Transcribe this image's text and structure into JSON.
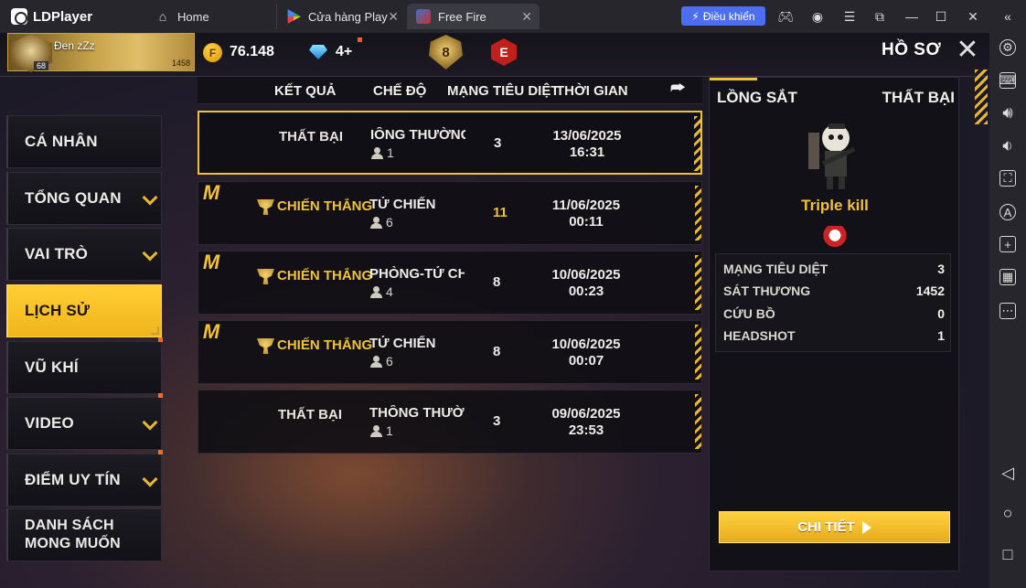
{
  "emulator": {
    "brand": "LDPlayer",
    "tabs": [
      {
        "label": "Home"
      },
      {
        "label": "Cửa hàng Play"
      },
      {
        "label": "Free Fire"
      }
    ],
    "control_button": "Điều khiển"
  },
  "header": {
    "player_name": "Đen zZz",
    "player_level": "68",
    "player_uid": "1458",
    "coins": "76.148",
    "diamonds": "4+",
    "rank_badge": "8",
    "rank_letter": "E",
    "title": "HỒ SƠ"
  },
  "nav": {
    "items": [
      {
        "label": "CÁ NHÂN",
        "active": false
      },
      {
        "label": "TỔNG QUAN",
        "active": false
      },
      {
        "label": "VAI TRÒ",
        "active": false
      },
      {
        "label": "LỊCH SỬ",
        "active": true
      },
      {
        "label": "VŨ KHÍ",
        "active": false
      },
      {
        "label": "VIDEO",
        "active": false
      },
      {
        "label": "ĐIỂM UY TÍN",
        "active": false
      },
      {
        "label": "DANH SÁCH\nMONG MUỐN",
        "active": false
      }
    ]
  },
  "history": {
    "columns": {
      "result": "KẾT QUẢ",
      "mode": "CHẾ ĐỘ",
      "kills": "MẠNG TIÊU DIỆT",
      "time": "THỜI GIAN"
    },
    "rows": [
      {
        "result": "THẤT BẠI",
        "win": false,
        "mode": "IÔNG THƯỜNG-ĐỘ",
        "players": "1",
        "kills": "3",
        "date": "13/06/2025",
        "time": "16:31"
      },
      {
        "result": "CHIẾN THẮNG",
        "win": true,
        "mode": "TỬ CHIẾN",
        "players": "6",
        "kills": "11",
        "date": "11/06/2025",
        "time": "00:11"
      },
      {
        "result": "CHIẾN THẮNG",
        "win": true,
        "mode": "PHÒNG-TỬ CHIẾN",
        "players": "4",
        "kills": "8",
        "date": "10/06/2025",
        "time": "00:23"
      },
      {
        "result": "CHIẾN THẮNG",
        "win": true,
        "mode": "TỬ CHIẾN",
        "players": "6",
        "kills": "8",
        "date": "10/06/2025",
        "time": "00:07"
      },
      {
        "result": "THẤT BẠI",
        "win": false,
        "mode": "THÔNG THƯỜNG-Đ",
        "players": "1",
        "kills": "3",
        "date": "09/06/2025",
        "time": "23:53"
      }
    ]
  },
  "detail": {
    "map": "LỒNG SẮT",
    "result": "THẤT BẠI",
    "achievement": "Triple kill",
    "stats": [
      {
        "label": "MẠNG TIÊU DIỆT",
        "value": "3"
      },
      {
        "label": "SÁT THƯƠNG",
        "value": "1452"
      },
      {
        "label": "CỨU BỒ",
        "value": "0"
      },
      {
        "label": "HEADSHOT",
        "value": "1"
      }
    ],
    "button": "CHI TIẾT"
  },
  "colors": {
    "accent": "#f0c238",
    "emulator_blue": "#4d6ef0",
    "background": "#1d1a28"
  }
}
